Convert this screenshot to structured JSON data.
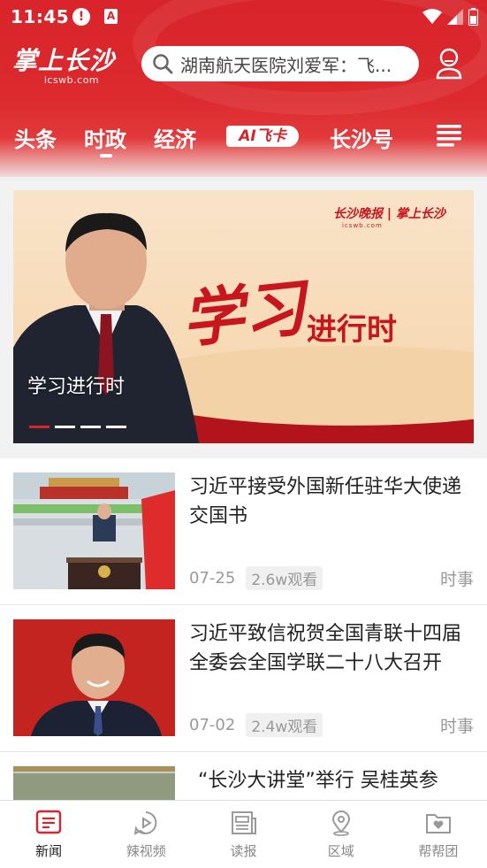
{
  "status_bar": {
    "time": "11:45"
  },
  "header": {
    "logo_text": "掌上长沙",
    "logo_domain": "icswb.com",
    "search_text": "湖南航天医院刘爱军：飞..."
  },
  "tabs": [
    {
      "label": "头条"
    },
    {
      "label": "时政",
      "selected": true
    },
    {
      "label": "经济"
    },
    {
      "label": "AI飞卡"
    },
    {
      "label": "长沙号"
    }
  ],
  "banner": {
    "brand": "长沙晚报 | 掌上长沙",
    "brand_sub": "icswb.com",
    "study_text": "学习",
    "progress_text": "进行时",
    "caption": "学习进行时",
    "slide_count": 4,
    "active_slide": 1
  },
  "news": [
    {
      "title": "习近平接受外国新任驻华大使递交国书",
      "date": "07-25",
      "views": "2.6w观看",
      "category": "时事"
    },
    {
      "title": "习近平致信祝贺全国青联十四届全委会全国学联二十八大召开",
      "date": "07-02",
      "views": "2.4w观看",
      "category": "时事"
    },
    {
      "title": "“长沙大讲堂”举行 吴桂英参"
    }
  ],
  "bottom_nav": [
    {
      "label": "新闻",
      "icon": "news-icon",
      "active": true
    },
    {
      "label": "辣视频",
      "icon": "video-icon"
    },
    {
      "label": "读报",
      "icon": "newspaper-icon"
    },
    {
      "label": "区域",
      "icon": "location-icon"
    },
    {
      "label": "帮帮团",
      "icon": "folder-heart-icon"
    }
  ],
  "colors": {
    "brand_red": "#d8242a",
    "text_dark": "#222222",
    "text_muted": "#999999"
  }
}
